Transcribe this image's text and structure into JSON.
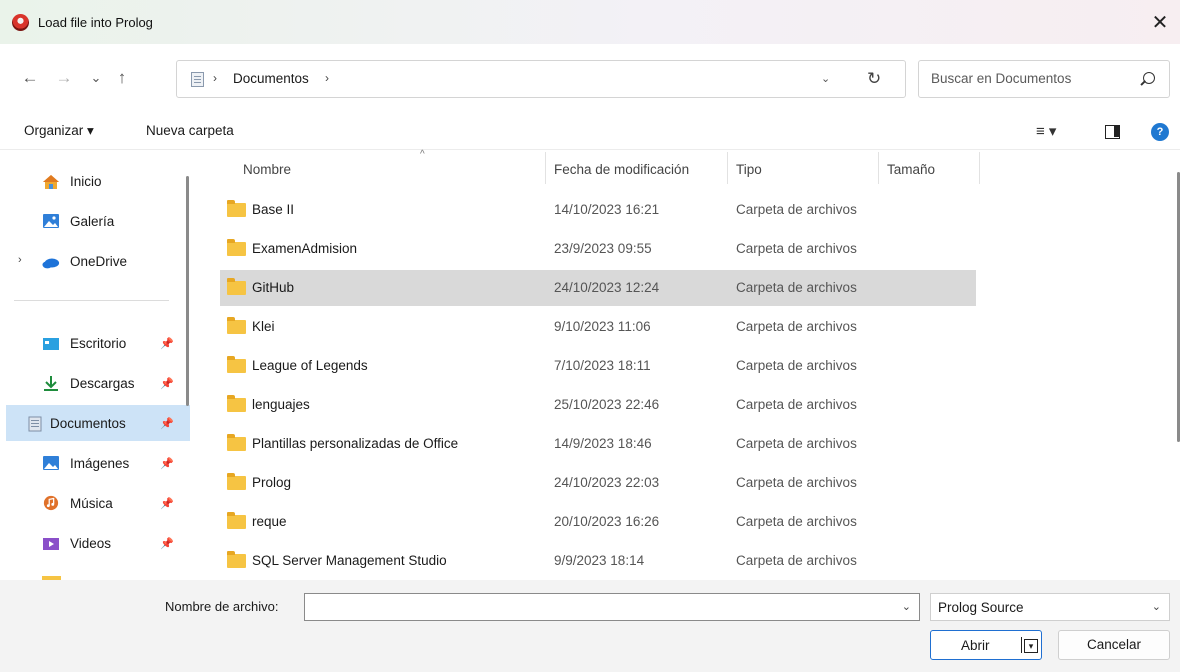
{
  "window": {
    "title": "Load file into Prolog",
    "close_glyph": "✕"
  },
  "nav": {
    "back": "←",
    "forward": "→",
    "recent": "⌄",
    "up": "↑"
  },
  "address": {
    "sep": "›",
    "crumb": "Documentos",
    "dropdown": "⌄",
    "refresh": "↻"
  },
  "search": {
    "placeholder": "Buscar en Documentos"
  },
  "toolbar": {
    "organize": "Organizar ▾",
    "new_folder": "Nueva carpeta",
    "view": "≡ ▾",
    "help": "?"
  },
  "sidebar": {
    "items": [
      {
        "label": "Inicio",
        "icon": "home-icon"
      },
      {
        "label": "Galería",
        "icon": "gallery-icon"
      },
      {
        "label": "OneDrive",
        "icon": "onedrive-icon"
      },
      {
        "label": "Escritorio",
        "icon": "desktop-icon"
      },
      {
        "label": "Descargas",
        "icon": "download-icon"
      },
      {
        "label": "Documentos",
        "icon": "documents-icon"
      },
      {
        "label": "Imágenes",
        "icon": "pictures-icon"
      },
      {
        "label": "Música",
        "icon": "music-icon"
      },
      {
        "label": "Videos",
        "icon": "videos-icon"
      }
    ],
    "expander": "›",
    "pin": "📌"
  },
  "columns": {
    "name": "Nombre",
    "date": "Fecha de modificación",
    "type": "Tipo",
    "size": "Tamaño",
    "sort": "^"
  },
  "files": [
    {
      "name": "Base II",
      "date": "14/10/2023 16:21",
      "type": "Carpeta de archivos"
    },
    {
      "name": "ExamenAdmision",
      "date": "23/9/2023 09:55",
      "type": "Carpeta de archivos"
    },
    {
      "name": "GitHub",
      "date": "24/10/2023 12:24",
      "type": "Carpeta de archivos"
    },
    {
      "name": "Klei",
      "date": "9/10/2023 11:06",
      "type": "Carpeta de archivos"
    },
    {
      "name": "League of Legends",
      "date": "7/10/2023 18:11",
      "type": "Carpeta de archivos"
    },
    {
      "name": "lenguajes",
      "date": "25/10/2023 22:46",
      "type": "Carpeta de archivos"
    },
    {
      "name": "Plantillas personalizadas de Office",
      "date": "14/9/2023 18:46",
      "type": "Carpeta de archivos"
    },
    {
      "name": "Prolog",
      "date": "24/10/2023 22:03",
      "type": "Carpeta de archivos"
    },
    {
      "name": "reque",
      "date": "20/10/2023 16:26",
      "type": "Carpeta de archivos"
    },
    {
      "name": "SQL Server Management Studio",
      "date": "9/9/2023 18:14",
      "type": "Carpeta de archivos"
    }
  ],
  "bottom": {
    "filename_label": "Nombre de archivo:",
    "filename_value": "",
    "filetype": "Prolog Source",
    "open": "Abrir",
    "open_arrow": "▾",
    "cancel": "Cancelar",
    "chev": "⌄"
  },
  "colors": {
    "accent": "#1f6fd1",
    "selection_sidebar": "#cde3f7",
    "selection_row": "#d9d9d9",
    "folder": "#f6c443"
  }
}
